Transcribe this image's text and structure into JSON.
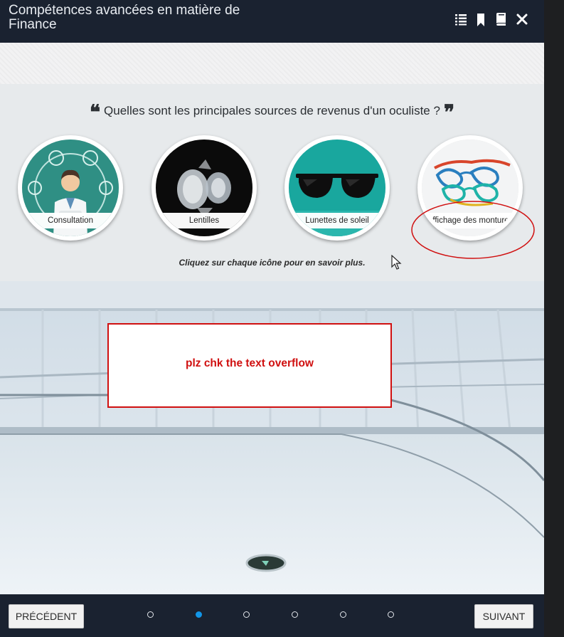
{
  "header": {
    "title": "Compétences avancées en matière de Finance",
    "icons": [
      "menu-list-icon",
      "bookmark-icon",
      "glossary-book-icon",
      "close-icon"
    ]
  },
  "question": {
    "open_quote": "❝",
    "text": "Quelles sont les principales sources de revenus d'un oculiste ?",
    "close_quote": "❞"
  },
  "topics": [
    {
      "label": "Consultation",
      "icon": "doctor-consultation-image"
    },
    {
      "label": "Lentilles",
      "icon": "contact-lens-image"
    },
    {
      "label": "Lunettes de soleil",
      "icon": "sunglasses-image"
    },
    {
      "label": "Affichage des montures",
      "icon": "eyeglass-frames-image"
    }
  ],
  "instruction": "Cliquez sur chaque icône pour en savoir plus.",
  "annotation": {
    "text": "plz chk the text overflow",
    "color": "#d01010"
  },
  "footer": {
    "prev_label": "PRÉCÉDENT",
    "next_label": "SUIVANT",
    "page_count": 6,
    "current_page": 2
  },
  "colors": {
    "accent": "#1296e8",
    "header_bg": "#1a2230",
    "annotation_red": "#d01010"
  }
}
